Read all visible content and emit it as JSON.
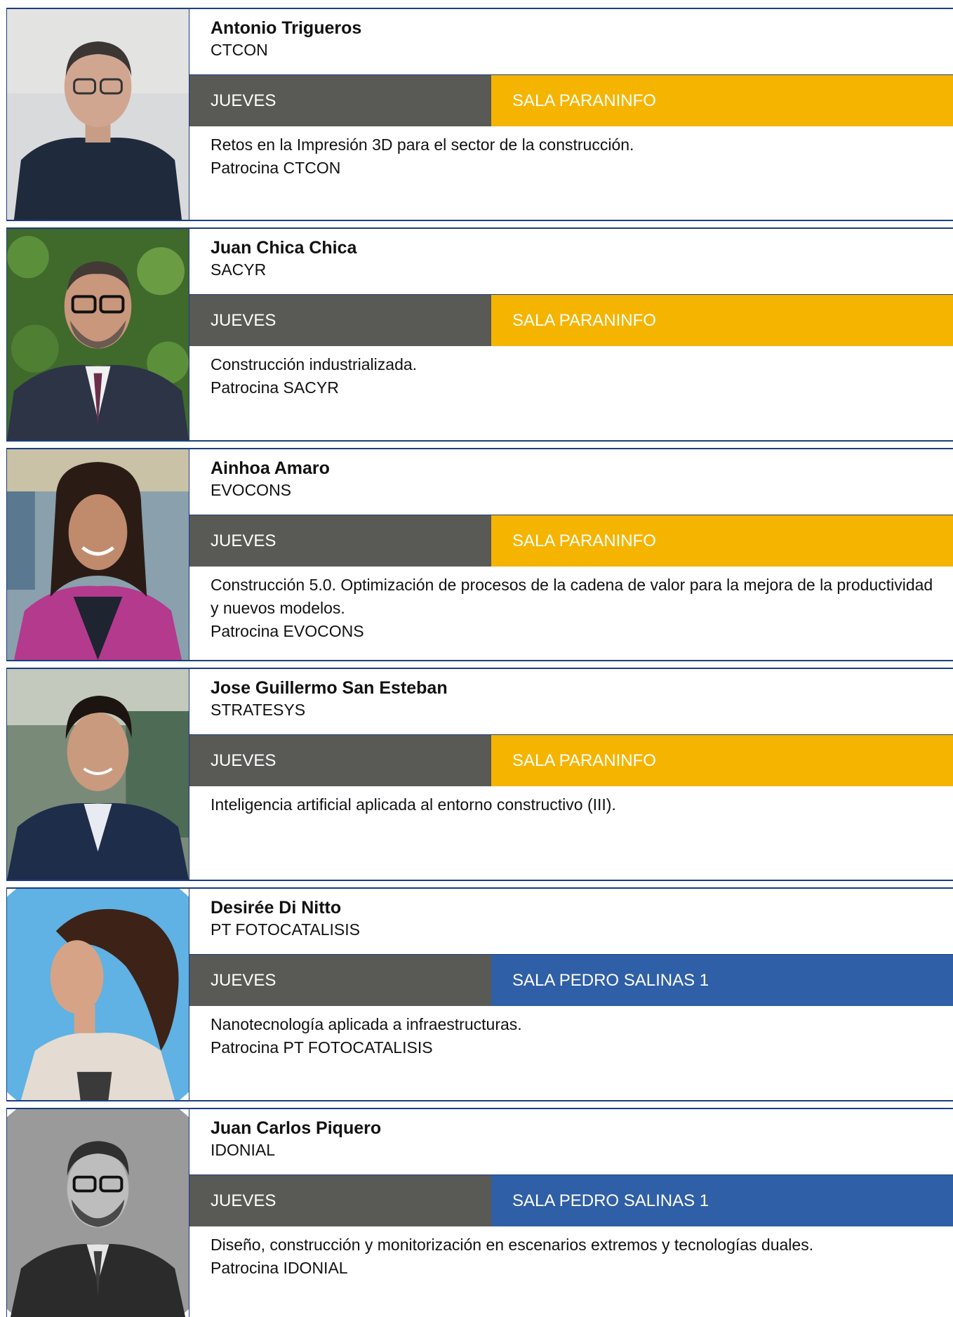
{
  "colors": {
    "frame": "#1d3d7e",
    "day_bar": "#595956",
    "paraninfo": "#f5b400",
    "pedro_salinas": "#2f5fa6"
  },
  "speakers": [
    {
      "name": "Antonio Trigueros",
      "org": "CTCON",
      "day": "JUEVES",
      "room": "SALA PARANINFO",
      "room_color": "#f5b400",
      "desc": "Retos en la Impresión 3D para el sector de la construcción.",
      "sponsor": "Patrocina CTCON"
    },
    {
      "name": "Juan Chica Chica",
      "org": "SACYR",
      "day": "JUEVES",
      "room": "SALA PARANINFO",
      "room_color": "#f5b400",
      "desc": "Construcción industrializada.",
      "sponsor": "Patrocina SACYR"
    },
    {
      "name": "Ainhoa Amaro",
      "org": "EVOCONS",
      "day": "JUEVES",
      "room": "SALA PARANINFO",
      "room_color": "#f5b400",
      "desc": "Construcción 5.0. Optimización de procesos de la cadena de valor para la mejora de la productividad y nuevos modelos.",
      "sponsor": "Patrocina EVOCONS"
    },
    {
      "name": "Jose Guillermo San Esteban",
      "org": "STRATESYS",
      "day": "JUEVES",
      "room": "SALA PARANINFO",
      "room_color": "#f5b400",
      "desc": "Inteligencia artificial aplicada al entorno constructivo (III).",
      "sponsor": ""
    },
    {
      "name": "Desirée Di Nitto",
      "org": "PT FOTOCATALISIS",
      "day": "JUEVES",
      "room": "SALA PEDRO SALINAS 1",
      "room_color": "#2f5fa6",
      "desc": "Nanotecnología aplicada a infraestructuras.",
      "sponsor": "Patrocina PT FOTOCATALISIS"
    },
    {
      "name": "Juan Carlos Piquero",
      "org": "IDONIAL",
      "day": "JUEVES",
      "room": "SALA PEDRO SALINAS 1",
      "room_color": "#2f5fa6",
      "desc": "Diseño, construcción y monitorización en escenarios extremos y tecnologías duales.",
      "sponsor": "Patrocina IDONIAL"
    }
  ]
}
